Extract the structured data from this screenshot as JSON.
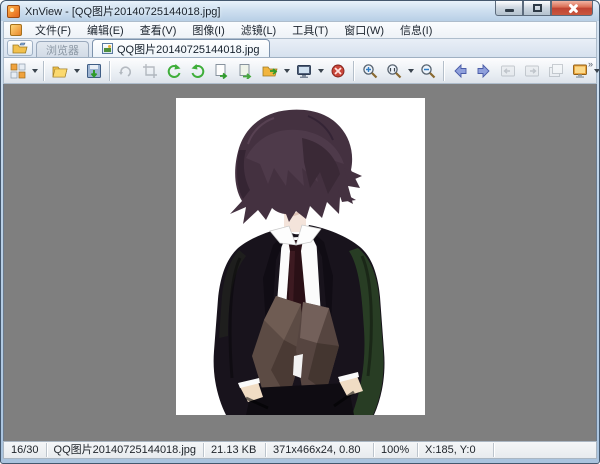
{
  "window": {
    "title": "XnView - [QQ图片20140725144018.jpg]"
  },
  "menu": {
    "items": [
      {
        "label": "文件(F)"
      },
      {
        "label": "编辑(E)"
      },
      {
        "label": "查看(V)"
      },
      {
        "label": "图像(I)"
      },
      {
        "label": "滤镜(L)"
      },
      {
        "label": "工具(T)"
      },
      {
        "label": "窗口(W)"
      },
      {
        "label": "信息(I)"
      }
    ]
  },
  "tabs": {
    "browser_label": "浏览器",
    "active_label": "QQ图片20140725144018.jpg"
  },
  "toolbar": {
    "icons": [
      "browser-icon",
      "open-icon",
      "save-icon",
      "undo-icon",
      "crop-icon",
      "rotate-left-icon",
      "rotate-right-icon",
      "copy-page-icon",
      "move-page-icon",
      "copy-to-folder-icon",
      "slideshow-icon",
      "delete-icon",
      "zoom-in-icon",
      "zoom-ratio-icon",
      "zoom-out-icon",
      "prev-image-icon",
      "next-image-icon",
      "first-frame-icon",
      "next-frame-icon",
      "multipage-icon",
      "monitor-icon",
      "refresh-icon",
      "fullscreen-icon"
    ],
    "overflow_glyph": "»"
  },
  "statusbar": {
    "cells": [
      "16/30",
      "QQ图片20140725144018.jpg",
      "21.13 KB",
      "371x466x24, 0.80",
      "100%",
      "X:185, Y:0"
    ]
  },
  "colors": {
    "titlebar": "#cfe0f0",
    "viewer_bg": "#7f7f7f",
    "close_button": "#bf4433",
    "rotate_green": "#3fae3a",
    "arrow_blue": "#8195d8",
    "monitor_orange": "#e8a33c"
  }
}
